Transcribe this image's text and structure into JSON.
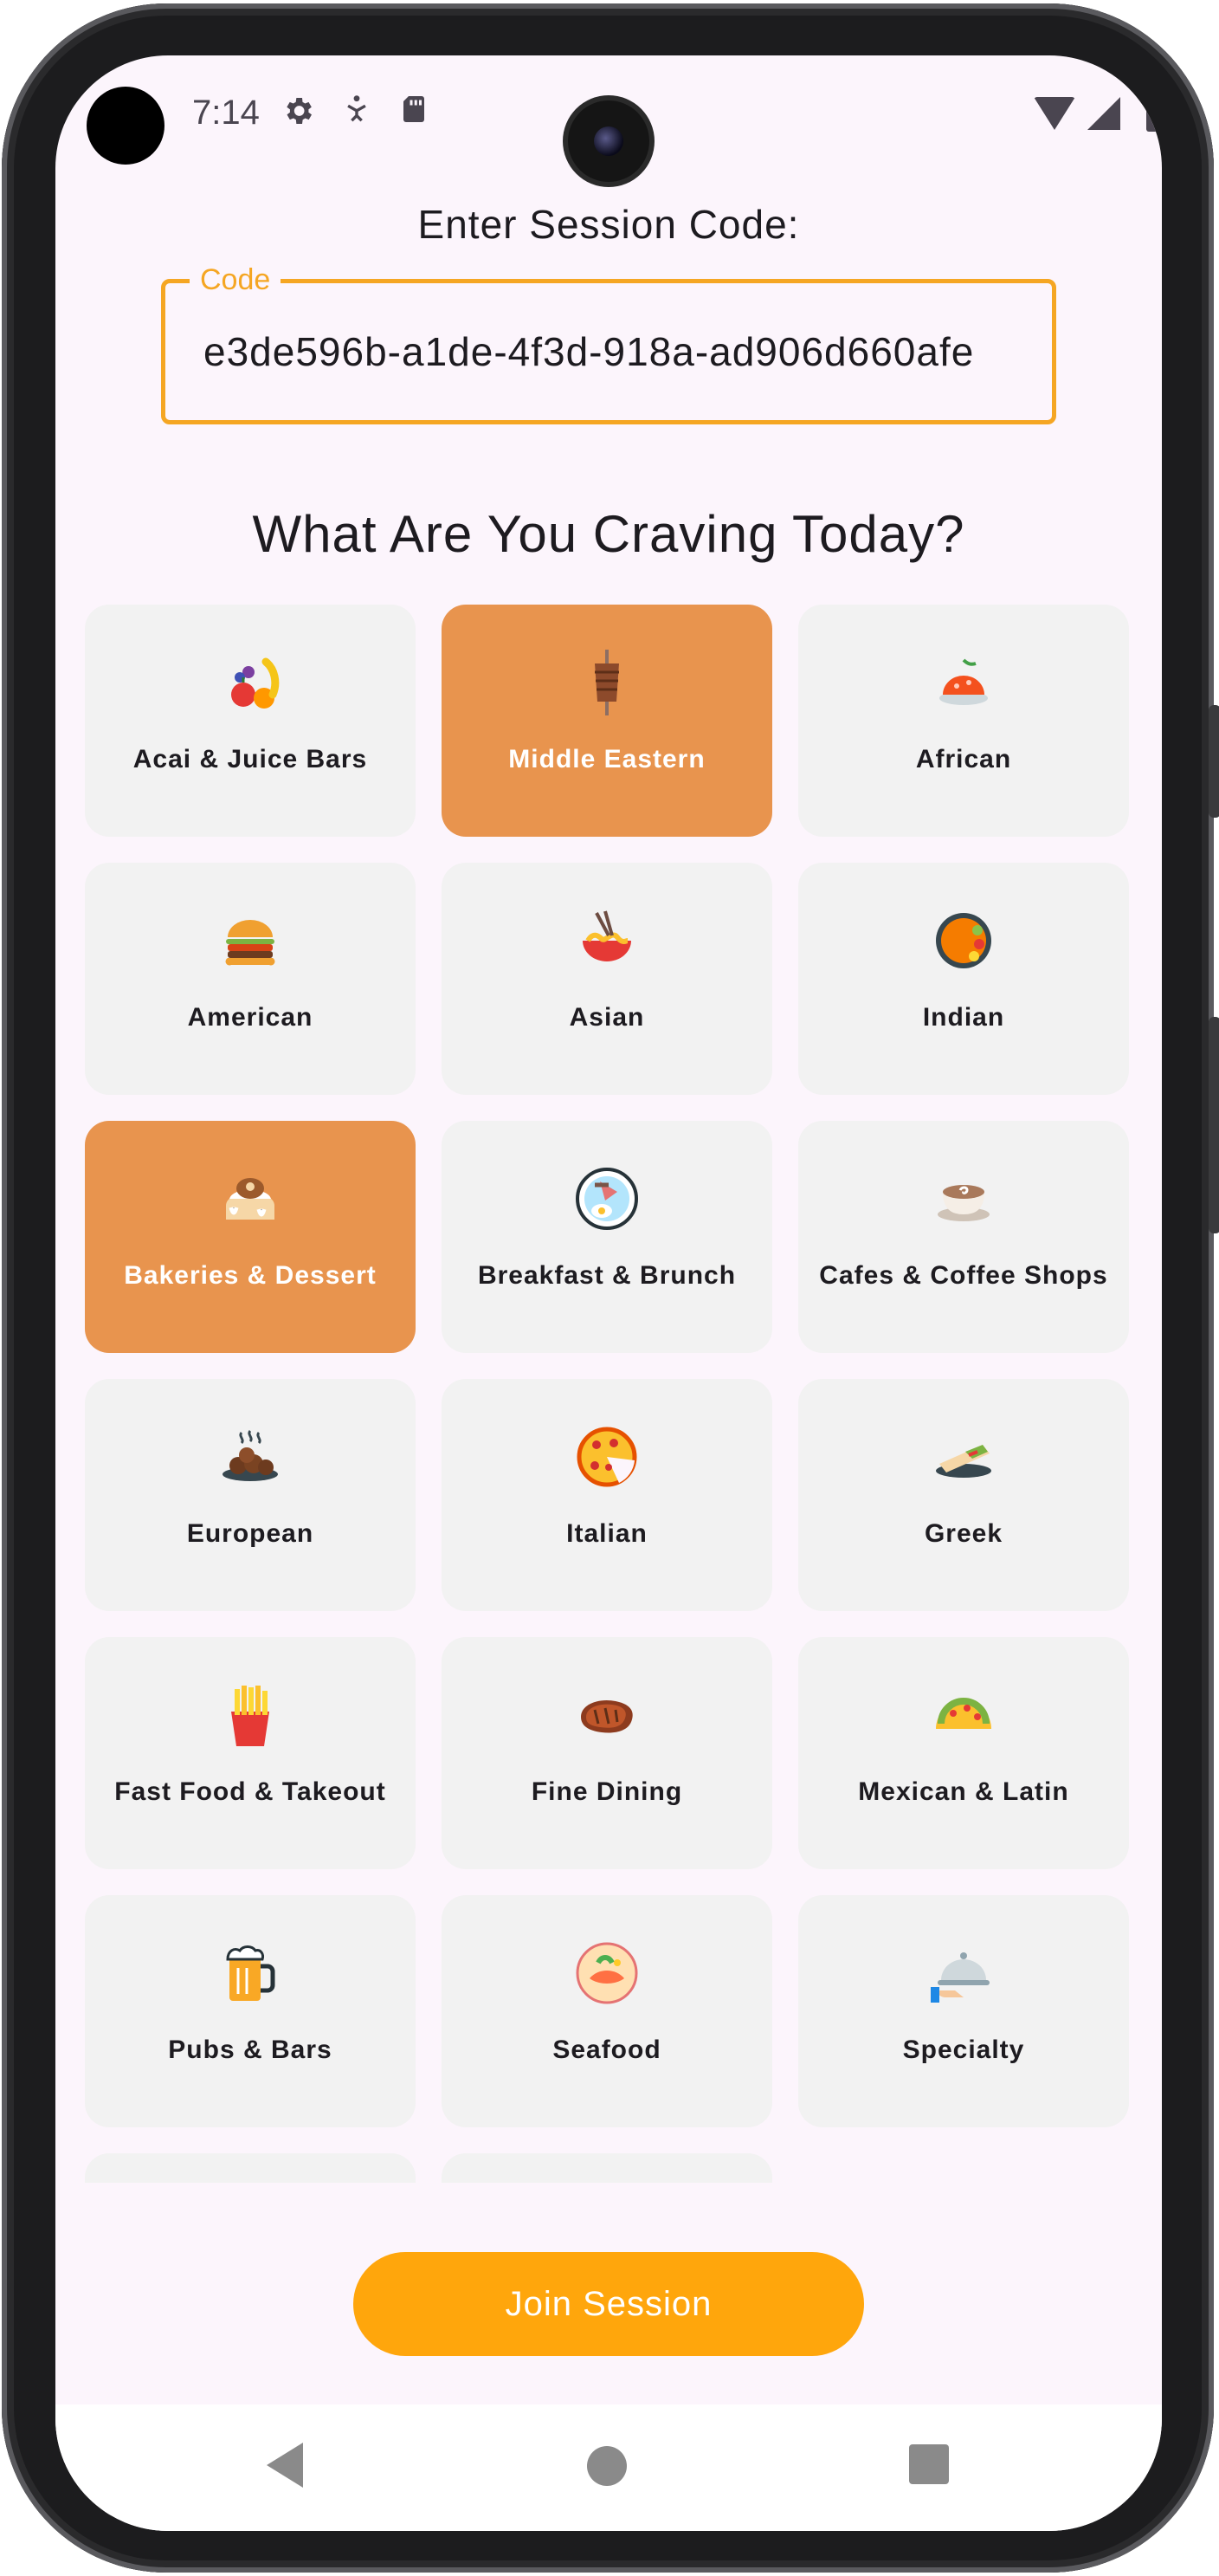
{
  "status_bar": {
    "time": "7:14"
  },
  "session": {
    "label": "Enter Session Code:",
    "field_legend": "Code",
    "field_value": "e3de596b-a1de-4f3d-918a-ad906d660afe"
  },
  "craving_title": "What Are You Craving Today?",
  "categories": [
    {
      "label": "Acai & Juice Bars",
      "icon": "fruit-icon",
      "selected": false
    },
    {
      "label": "Middle Eastern",
      "icon": "kebab-icon",
      "selected": true
    },
    {
      "label": "African",
      "icon": "african-dish-icon",
      "selected": false
    },
    {
      "label": "American",
      "icon": "burger-icon",
      "selected": false
    },
    {
      "label": "Asian",
      "icon": "noodle-bowl-icon",
      "selected": false
    },
    {
      "label": "Indian",
      "icon": "indian-plate-icon",
      "selected": false
    },
    {
      "label": "Bakeries & Dessert",
      "icon": "cinnamon-roll-icon",
      "selected": true
    },
    {
      "label": "Breakfast & Brunch",
      "icon": "breakfast-plate-icon",
      "selected": false
    },
    {
      "label": "Cafes & Coffee Shops",
      "icon": "coffee-cup-icon",
      "selected": false
    },
    {
      "label": "European",
      "icon": "meatballs-icon",
      "selected": false
    },
    {
      "label": "Italian",
      "icon": "pizza-icon",
      "selected": false
    },
    {
      "label": "Greek",
      "icon": "gyro-wrap-icon",
      "selected": false
    },
    {
      "label": "Fast Food & Takeout",
      "icon": "fries-icon",
      "selected": false
    },
    {
      "label": "Fine Dining",
      "icon": "steak-icon",
      "selected": false
    },
    {
      "label": "Mexican & Latin",
      "icon": "taco-icon",
      "selected": false
    },
    {
      "label": "Pubs & Bars",
      "icon": "beer-mug-icon",
      "selected": false
    },
    {
      "label": "Seafood",
      "icon": "seafood-plate-icon",
      "selected": false
    },
    {
      "label": "Specialty",
      "icon": "cloche-icon",
      "selected": false
    }
  ],
  "join_button": {
    "label": "Join Session"
  },
  "colors": {
    "accent": "#ffa60c",
    "selected_tile": "#e8944e",
    "tile": "#f2f2f2",
    "field_border": "#f5a623",
    "background": "#fcf5fc"
  }
}
